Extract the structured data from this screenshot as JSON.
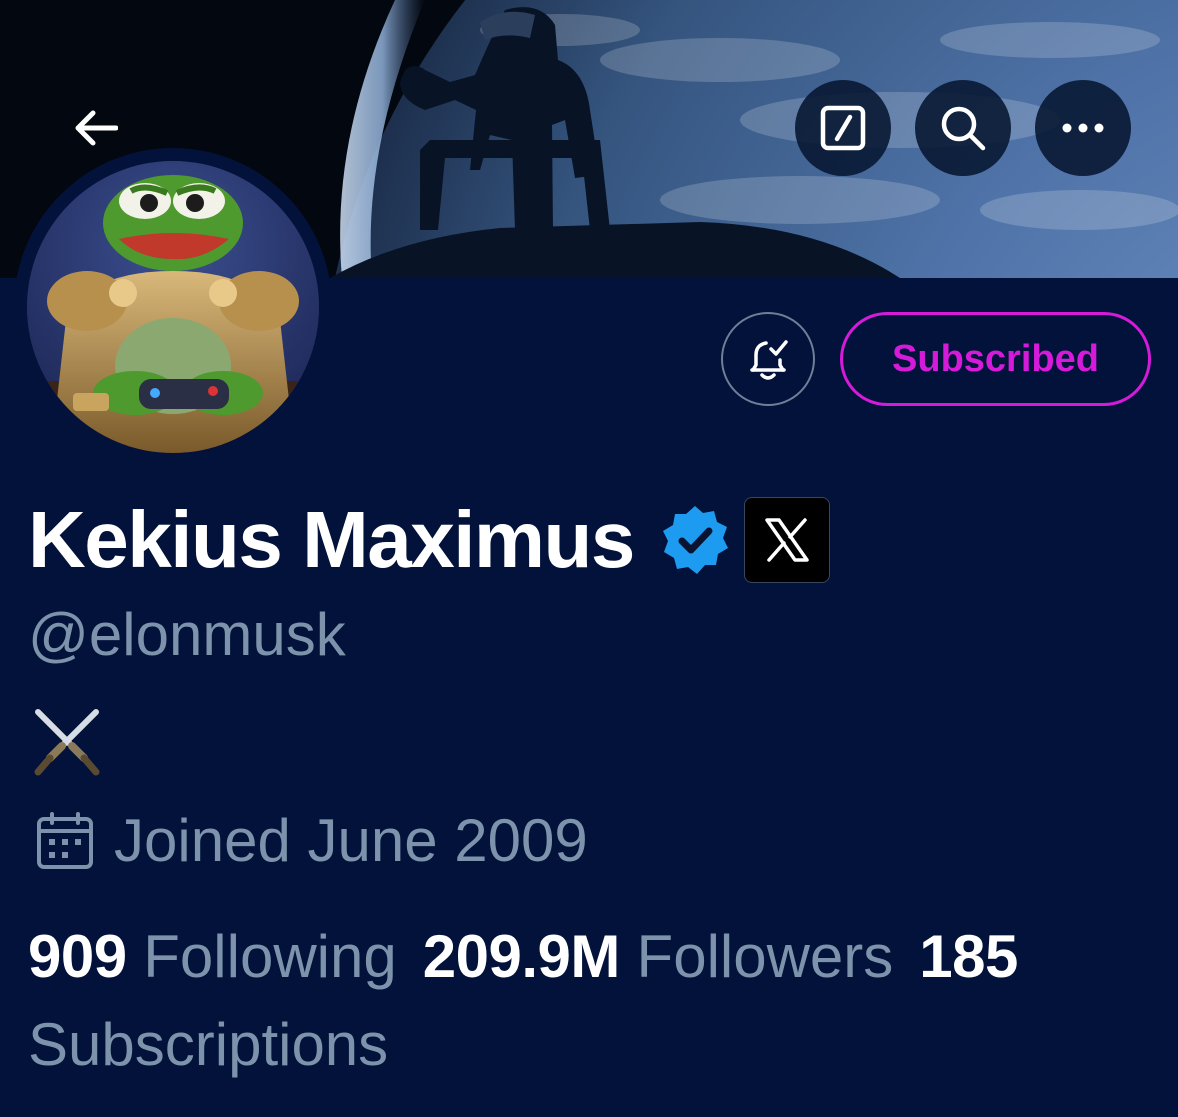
{
  "profile": {
    "display_name": "Kekius Maximus",
    "handle": "@elonmusk",
    "joined": "Joined June 2009",
    "bio_icon": "crossed-swords-icon"
  },
  "actions": {
    "subscribed_label": "Subscribed",
    "back_icon": "back-arrow-icon",
    "edit_icon": "compose-icon",
    "search_icon": "search-icon",
    "more_icon": "more-icon",
    "bell_icon": "notification-bell-icon"
  },
  "stats": {
    "following_count": "909",
    "following_label": "Following",
    "followers_count": "209.9M",
    "followers_label": "Followers",
    "subscriptions_count": "185",
    "subscriptions_label": "Subscriptions"
  },
  "colors": {
    "background": "#02123a",
    "secondary_text": "#7d93ab",
    "subscribed_accent": "#d51ad9",
    "verified_blue": "#1d9bf0"
  }
}
